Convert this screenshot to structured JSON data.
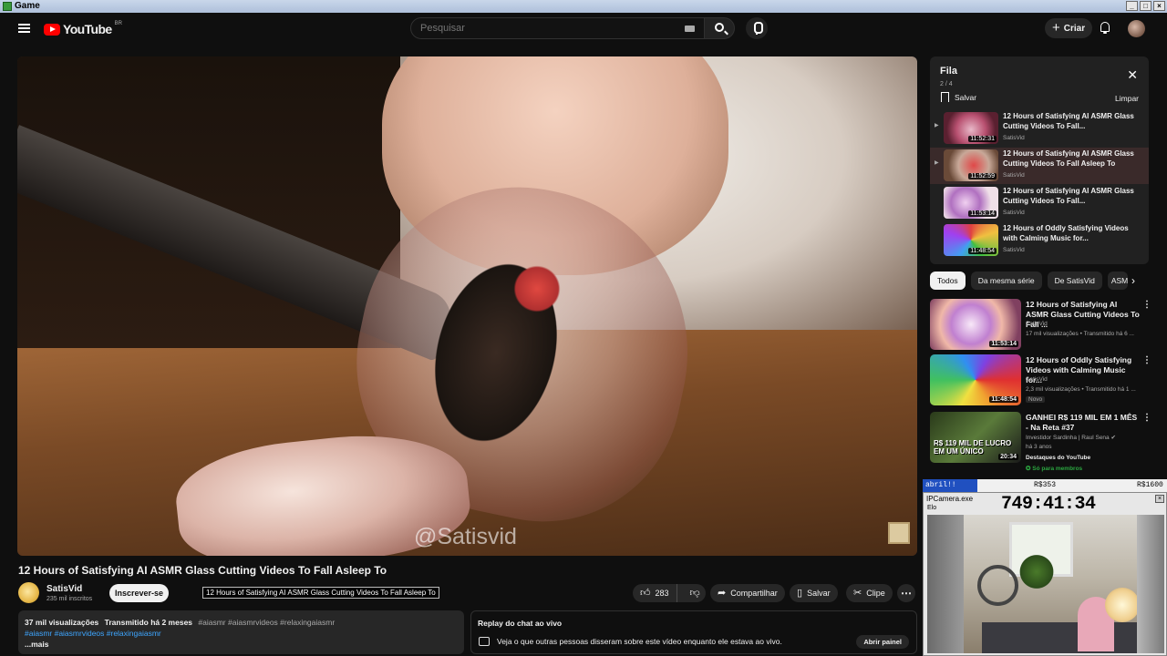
{
  "window": {
    "title": "Game"
  },
  "header": {
    "logo_text": "YouTube",
    "logo_country": "BR",
    "search_placeholder": "Pesquisar",
    "create_label": "Criar"
  },
  "player": {
    "watermark": "@Satisvid"
  },
  "video": {
    "title": "12 Hours of Satisfying AI ASMR Glass Cutting Videos To Fall Asleep To",
    "tooltip": "12 Hours of Satisfying AI ASMR Glass Cutting Videos To Fall Asleep To",
    "channel": "SatisVid",
    "subscribers": "235 mil inscritos",
    "subscribe_label": "Inscrever-se",
    "likes": "283",
    "share_label": "Compartilhar",
    "save_label": "Salvar",
    "clip_label": "Clipe",
    "more_label": "⋯"
  },
  "description": {
    "views": "37 mil visualizações",
    "streamed": "Transmitido há 2 meses",
    "tags_inline": "#aiasmr #aiasmrvideos #relaxingaiasmr",
    "tags_blue": "#aiasmr #aiasmrvideos #relaxingaiasmr",
    "more": "...mais"
  },
  "chat_replay": {
    "title": "Replay do chat ao vivo",
    "body": "Veja o que outras pessoas disseram sobre este vídeo enquanto ele estava ao vivo.",
    "button": "Abrir painel"
  },
  "queue": {
    "title": "Fila",
    "count": "2 / 4",
    "save_label": "Salvar",
    "clear_label": "Limpar",
    "items": [
      {
        "title": "12 Hours of Satisfying AI ASMR Glass Cutting Videos To Fall...",
        "channel": "SatisVid",
        "duration": "11:52:31"
      },
      {
        "title": "12 Hours of Satisfying AI ASMR Glass Cutting Videos To Fall Asleep To",
        "channel": "SatisVid",
        "duration": "11:52:59"
      },
      {
        "title": "12 Hours of Satisfying AI ASMR Glass Cutting Videos To Fall...",
        "channel": "SatisVid",
        "duration": "11:53:14"
      },
      {
        "title": "12 Hours of Oddly Satisfying Videos with Calming Music for...",
        "channel": "SatisVid",
        "duration": "11:48:54"
      }
    ]
  },
  "chips": [
    "Todos",
    "Da mesma série",
    "De SatisVid",
    "ASM"
  ],
  "recommendations": [
    {
      "title": "12 Hours of Satisfying AI ASMR Glass Cutting Videos To Fall ...",
      "channel": "SatisVid",
      "meta": "17 mil visualizações • Transmitido há 6 ...",
      "duration": "11:53:14"
    },
    {
      "title": "12 Hours of Oddly Satisfying Videos with Calming Music for...",
      "channel": "SatisVid",
      "meta": "2,3 mil visualizações • Transmitido há 1 ...",
      "badge": "Novo",
      "duration": "11:48:54"
    },
    {
      "title": "GANHEI R$ 119 MIL EM 1 MÊS - Na Reta #37",
      "channel": "Investidor Sardinha | Raul Sena ✔",
      "meta": "há 3 anos",
      "extra1": "Destaques do YouTube",
      "extra2": "✪ Só para membros",
      "duration": "20:34",
      "thumb_text": "R$ 119 MIL DE LUCRO EM UM ÚNICO"
    }
  ],
  "overlay": {
    "split_label": "abril!!",
    "value1": "R$353",
    "value2": "R$1600",
    "timer": "749:41:34",
    "camera_title": "IPCamera.exe",
    "camera_menu": "Elo"
  },
  "colors": {
    "accent_red": "#ff0000",
    "link_blue": "#3ea6ff",
    "member_green": "#2ba640"
  }
}
